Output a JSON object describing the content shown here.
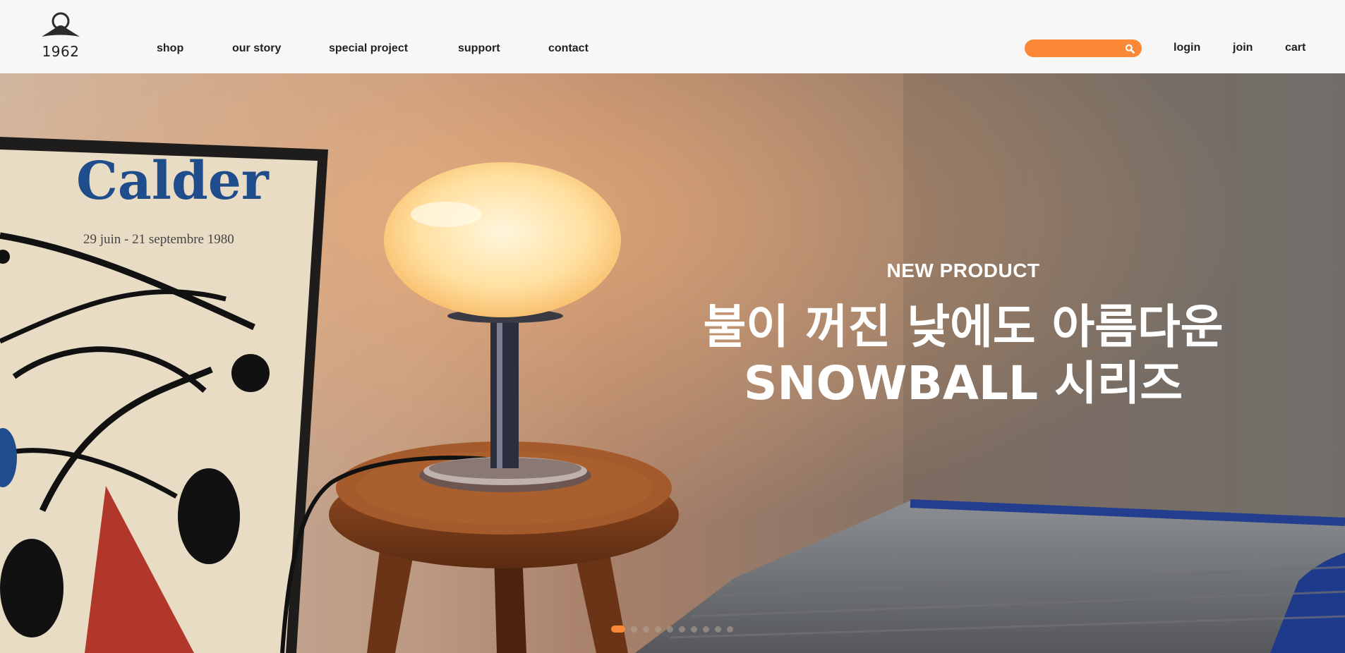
{
  "brand": {
    "logo_text": "1962"
  },
  "nav": {
    "items": [
      {
        "label": "shop"
      },
      {
        "label": "our story"
      },
      {
        "label": "special project"
      },
      {
        "label": "support"
      },
      {
        "label": "contact"
      }
    ]
  },
  "search": {
    "placeholder": "",
    "value": ""
  },
  "utility": {
    "login": "login",
    "join": "join",
    "cart": "cart"
  },
  "hero": {
    "subtitle": "NEW PRODUCT",
    "title_line1": "불이 꺼진 낮에도 아름다운",
    "title_line2": "SNOWBALL 시리즈",
    "poster_title": "Calder",
    "poster_date": "29 juin - 21 septembre 1980",
    "slide_count": 10,
    "active_slide": 1
  },
  "colors": {
    "accent": "#fb8836",
    "header_bg": "#f7f7f7",
    "text": "#222222"
  },
  "icons": {
    "search": "search-icon",
    "logo": "lamp-logo-icon"
  }
}
